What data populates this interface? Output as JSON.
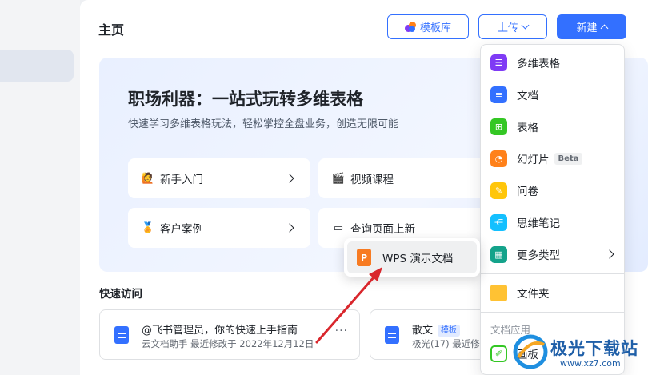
{
  "header": {
    "title": "主页",
    "template_btn": "模板库",
    "upload_btn": "上传",
    "new_btn": "新建"
  },
  "banner": {
    "title": "职场利器：一站式玩转多维表格",
    "subtitle": "快速学习多维表格玩法，轻松掌控全盘业务，创造无限可能",
    "cards": [
      {
        "label": "新手入门",
        "icon": "🙋"
      },
      {
        "label": "视频课程",
        "icon": "🎬"
      },
      {
        "label": "客户案例",
        "icon": "🏅"
      },
      {
        "label": "查询页面上新",
        "icon": "▭"
      }
    ]
  },
  "quick": {
    "title": "快速访问",
    "items": [
      {
        "title": "@飞书管理员，你的快速上手指南",
        "meta": "云文档助手 最近修改于 2022年12月12日",
        "more": "···"
      },
      {
        "title": "散文",
        "badge": "模板",
        "meta": "极光(17) 最近修改于"
      }
    ]
  },
  "menu": {
    "items": [
      {
        "label": "多维表格",
        "color": "#7f3bf5"
      },
      {
        "label": "文档",
        "color": "#3370ff"
      },
      {
        "label": "表格",
        "color": "#34c724"
      },
      {
        "label": "幻灯片",
        "color": "#ff811a",
        "badge": "Beta"
      },
      {
        "label": "问卷",
        "color": "#ffc60a"
      },
      {
        "label": "思维笔记",
        "color": "#14c0ff"
      },
      {
        "label": "更多类型",
        "color": "#14a38b"
      }
    ],
    "folder": "文件夹",
    "section_label": "文档应用",
    "whiteboard": "画板"
  },
  "tooltip": {
    "icon_letter": "P",
    "label": "WPS 演示文档"
  },
  "watermark": {
    "text": "极光下载站",
    "url": "www.xz7.com"
  }
}
